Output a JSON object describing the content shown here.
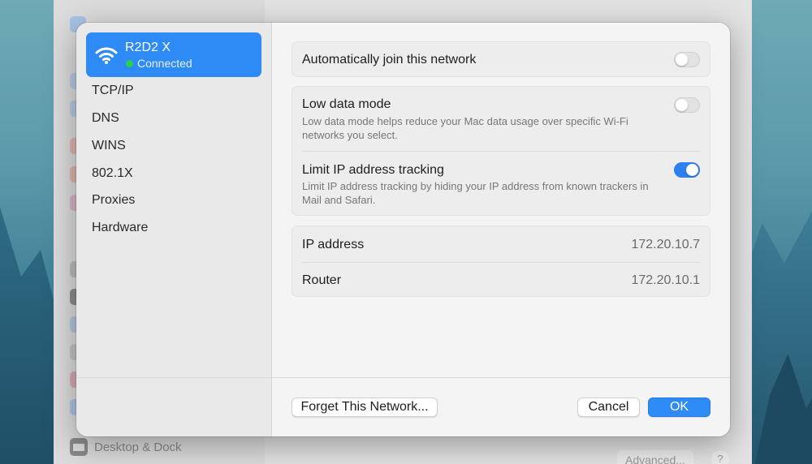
{
  "background": {
    "sidebar_bottom_item": "Desktop & Dock",
    "advanced_button": "Advanced...",
    "help_button": "?"
  },
  "sidebar": {
    "network_name": "R2D2 X",
    "network_status": "Connected",
    "items": [
      {
        "label": "TCP/IP"
      },
      {
        "label": "DNS"
      },
      {
        "label": "WINS"
      },
      {
        "label": "802.1X"
      },
      {
        "label": "Proxies"
      },
      {
        "label": "Hardware"
      }
    ]
  },
  "settings": {
    "auto_join": {
      "label": "Automatically join this network",
      "enabled": false
    },
    "low_data": {
      "label": "Low data mode",
      "description": "Low data mode helps reduce your Mac data usage over specific Wi-Fi networks you select.",
      "enabled": false
    },
    "limit_ip": {
      "label": "Limit IP address tracking",
      "description": "Limit IP address tracking by hiding your IP address from known trackers in Mail and Safari.",
      "enabled": true
    }
  },
  "info": {
    "ip_label": "IP address",
    "ip_value": "172.20.10.7",
    "router_label": "Router",
    "router_value": "172.20.10.1"
  },
  "footer": {
    "forget_label": "Forget This Network...",
    "cancel_label": "Cancel",
    "ok_label": "OK"
  },
  "colors": {
    "accent": "#2e8bf5",
    "connected": "#2bd04b"
  }
}
